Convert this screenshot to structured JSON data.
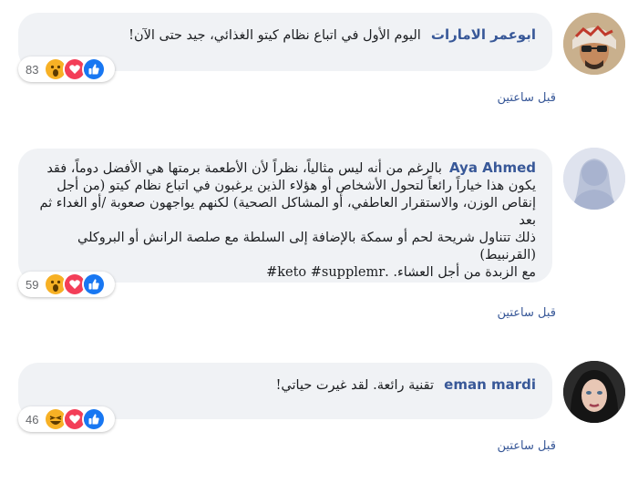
{
  "comments": [
    {
      "author": "ابوعمر الامارات",
      "text": "اليوم الأول في اتباع نظام كيتو الغذائي، جيد حتى الآن!",
      "reactions_count": "83",
      "reactions": [
        "wow",
        "love",
        "like"
      ],
      "time": "قبل ساعتين"
    },
    {
      "author": "Aya Ahmed",
      "text_lines": [
        "بالرغم من أنه ليس مثالياً، نظراً لأن الأطعمة برمتها هي الأفضل دوماً، فقد",
        "يكون هذا خياراً رائعاً لتحول الأشخاص أو هؤلاء الذين يرغبون في اتباع نظام كيتو (من أجل",
        "إنقاص الوزن، والاستقرار العاطفي، أو المشاكل الصحية) لكنهم يواجهون صعوبة /أو الغداء ثم بعد",
        "ذلك تتناول شريحة لحم أو سمكة بالإضافة إلى السلطة مع صلصة الرانش أو البروكلي (القرنبيط)",
        "مع الزبدة من أجل العشاء. .keto #supplemr#"
      ],
      "reactions_count": "59",
      "reactions": [
        "wow",
        "love",
        "like"
      ],
      "time": "قبل ساعتين"
    },
    {
      "author": "eman mardi",
      "text": "تقنية رائعة. لقد غيرت حياتي!",
      "reactions_count": "46",
      "reactions": [
        "haha",
        "love",
        "like"
      ],
      "time": "قبل ساعتين"
    }
  ],
  "colors": {
    "bubble_bg": "#f0f2f5",
    "author": "#385898",
    "like": "#1877f2",
    "love": "#f33e58",
    "emoji_yellow": "#f7b125"
  }
}
